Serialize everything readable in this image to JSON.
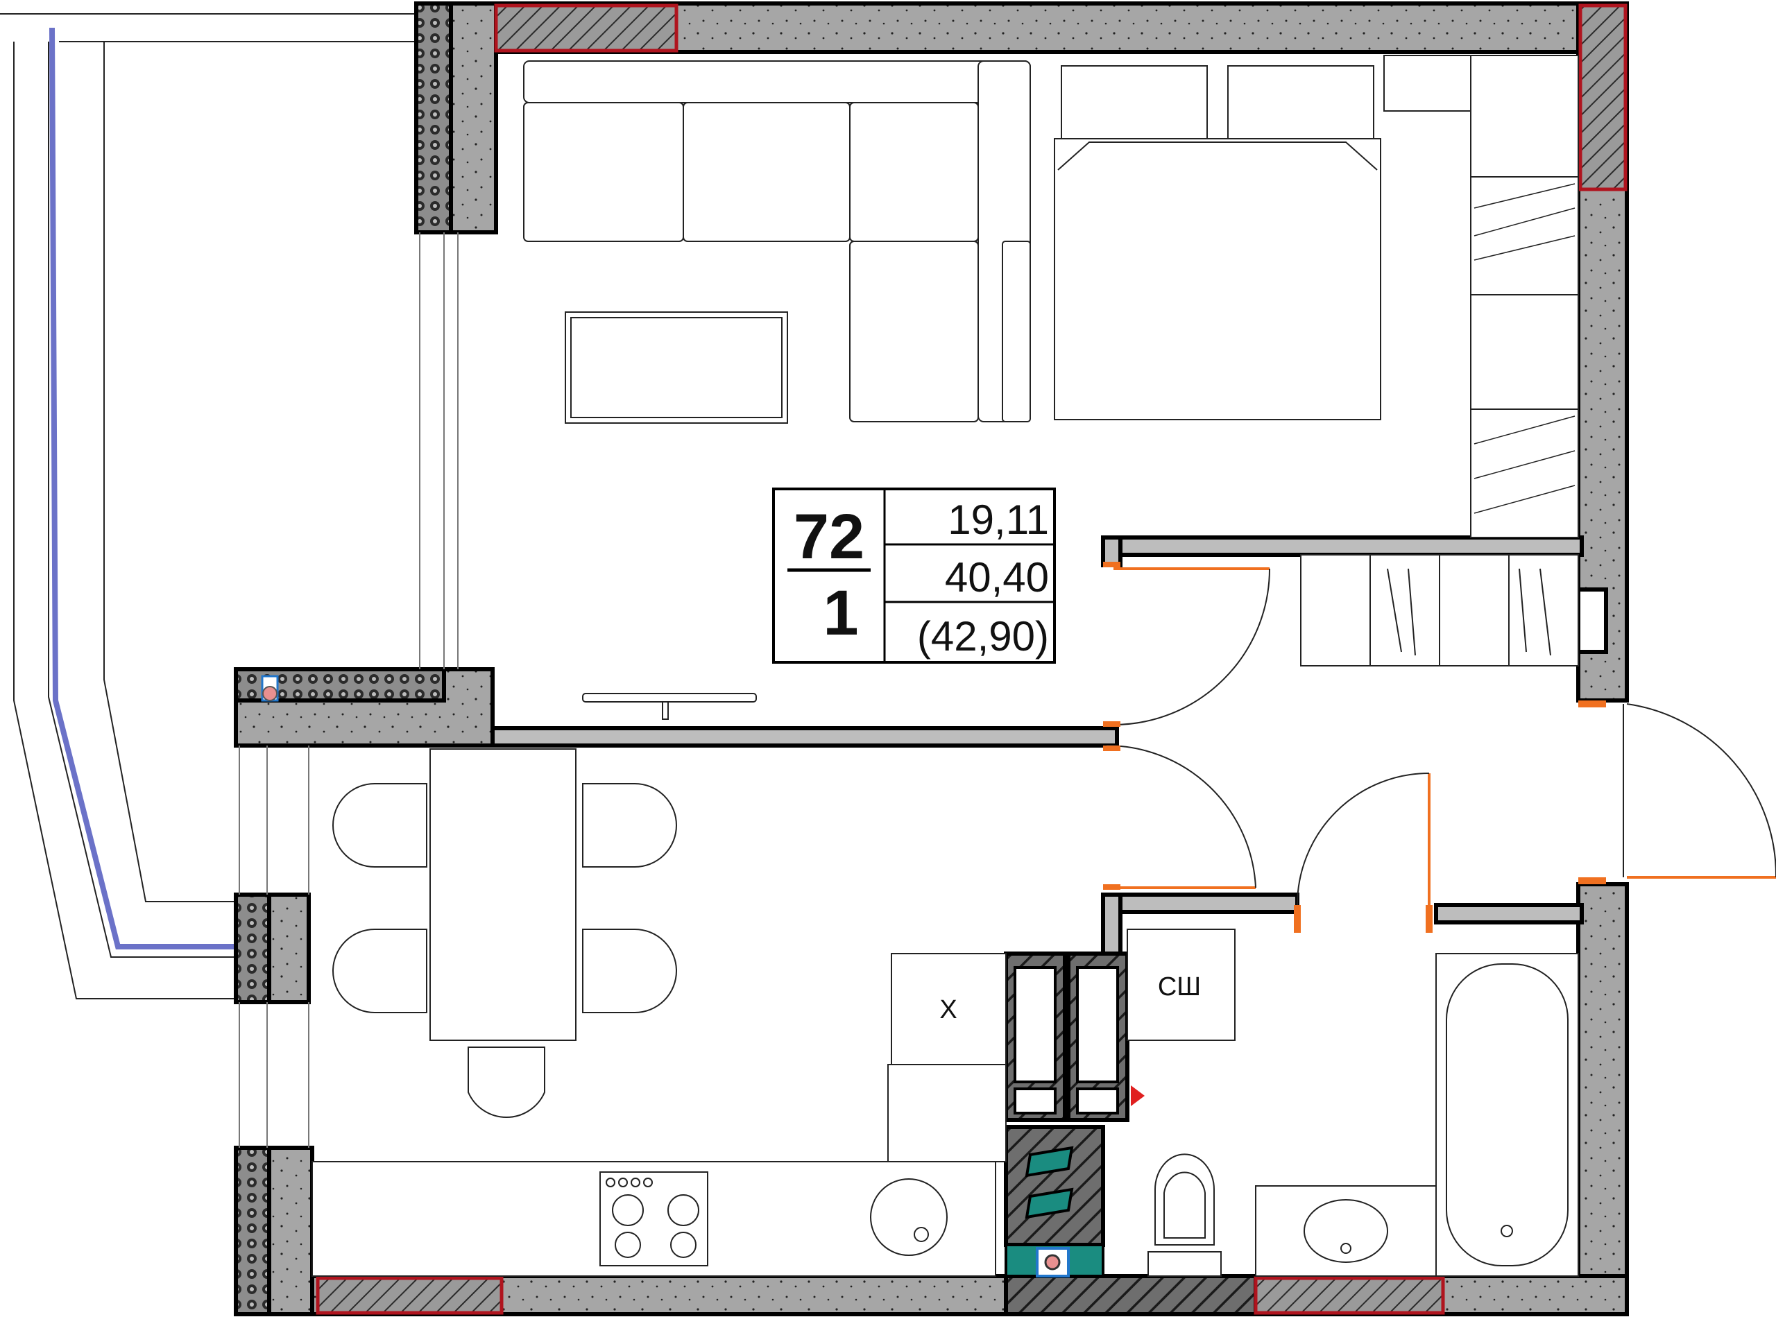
{
  "apartment": {
    "number": "72",
    "rooms": "1",
    "living_area": "19,11",
    "total_area": "40,40",
    "total_area_with_balcony": "(42,90)"
  },
  "fixtures": {
    "fridge_label": "Х",
    "wardrobe_label": "СШ"
  },
  "colors": {
    "concrete": "#a6a6a6",
    "wall_outline": "#000000",
    "window_frame_red": "#b0141e",
    "door_accent_orange": "#f07020",
    "glazing_blue": "#6b72c8",
    "shaft_teal": "#1a8c80",
    "marker_red": "#e02020"
  }
}
